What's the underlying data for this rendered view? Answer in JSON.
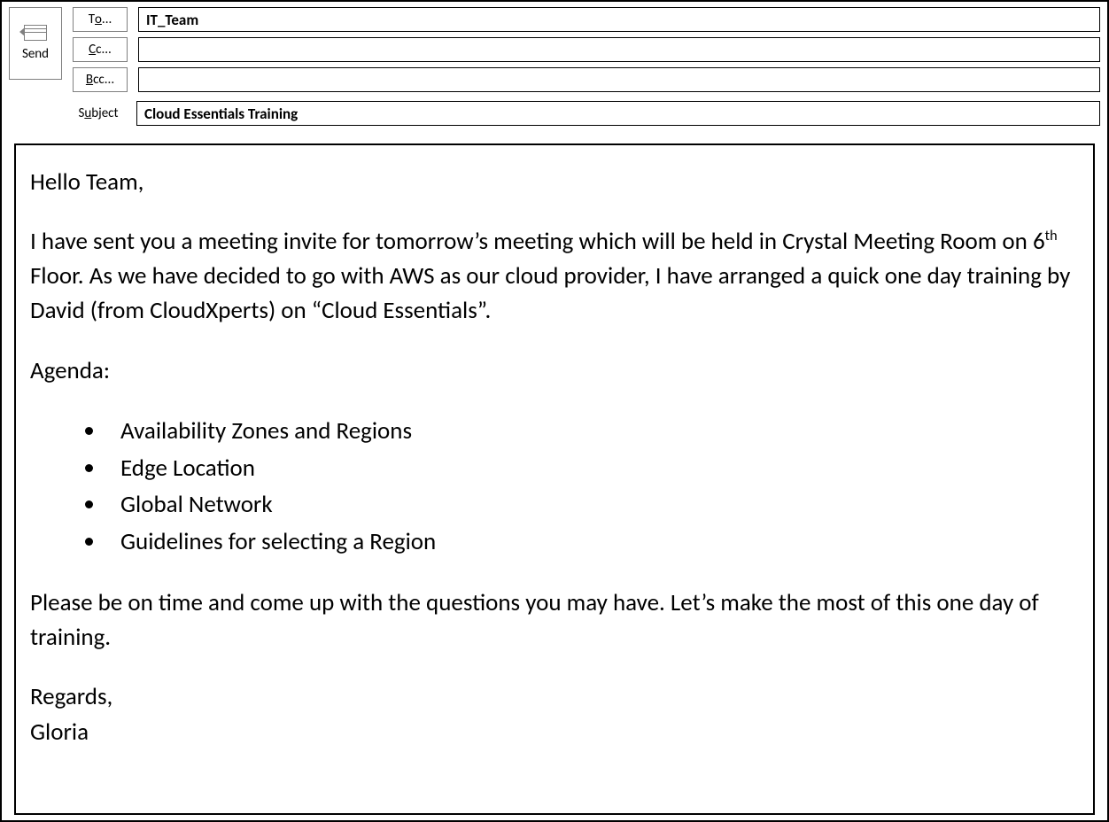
{
  "send": {
    "label": "Send"
  },
  "labels": {
    "to": {
      "prefix": "T",
      "ul": "o",
      "suffix": "..."
    },
    "cc": {
      "prefix": "",
      "ul": "C",
      "suffix": "c..."
    },
    "bcc": {
      "prefix": "",
      "ul": "B",
      "suffix": "cc..."
    },
    "subject": {
      "prefix": "S",
      "ul": "u",
      "suffix": "bject"
    }
  },
  "fields": {
    "to": "IT_Team",
    "cc": "",
    "bcc": "",
    "subject": "Cloud Essentials Training"
  },
  "body": {
    "greeting": "Hello Team,",
    "para1a": "I have sent you a meeting invite for tomorrow’s meeting which will be held in Crystal Meeting Room on 6",
    "para1sup": "th",
    "para1b": " Floor. As we have decided to go with AWS as our cloud provider, I have arranged a quick one day training by David (from CloudXperts) on “Cloud Essentials”.",
    "agenda_label": "Agenda:",
    "agenda": [
      "Availability Zones and Regions",
      "Edge Location",
      "Global Network",
      "Guidelines for selecting a Region"
    ],
    "para2": "Please be on time and come up with the questions you may have. Let’s make the most of this one day of training.",
    "regards": "Regards,",
    "sender": "Gloria"
  }
}
